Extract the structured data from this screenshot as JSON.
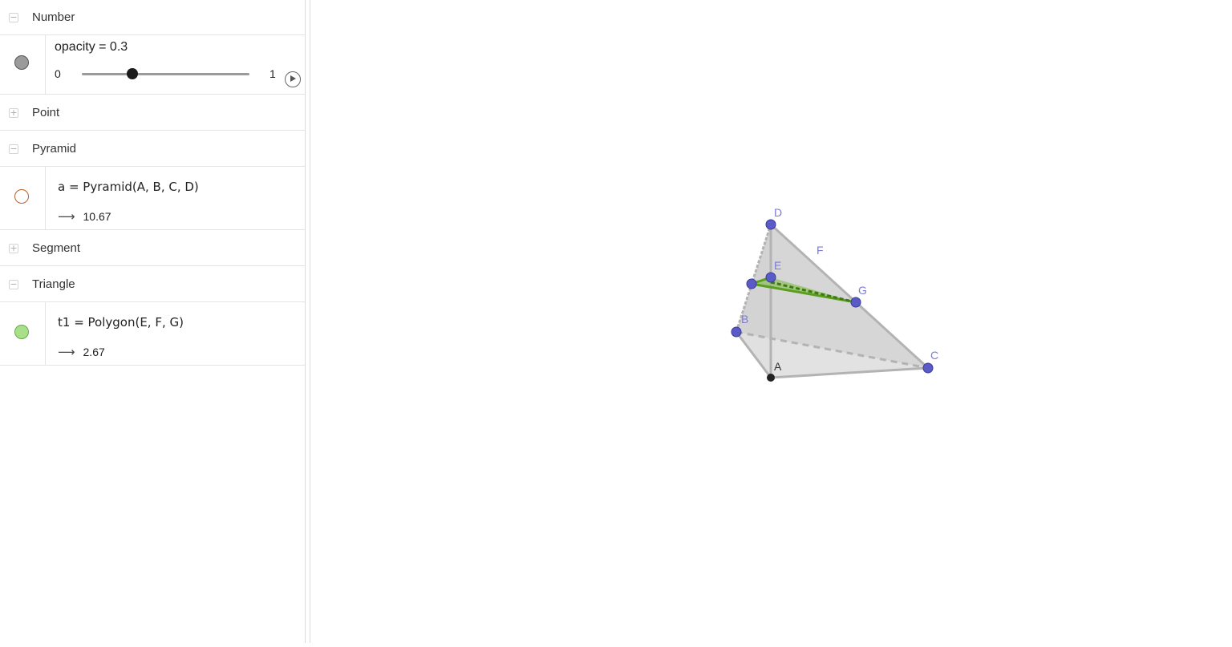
{
  "algebra": {
    "groups": {
      "number": {
        "label": "Number",
        "toggle": "−"
      },
      "point": {
        "label": "Point",
        "toggle": "+"
      },
      "pyramid": {
        "label": "Pyramid",
        "toggle": "−"
      },
      "segment": {
        "label": "Segment",
        "toggle": "+"
      },
      "triangle": {
        "label": "Triangle",
        "toggle": "−"
      }
    },
    "slider": {
      "text": "opacity = 0.3",
      "min": "0",
      "max": "1",
      "value": 0.3,
      "marble_color": "#9b9b9b"
    },
    "pyramid_item": {
      "definition": "a  =  Pyramid(A, B, C, D)",
      "arrow": "⟶",
      "value": "10.67",
      "marble_color": "#b5602a"
    },
    "triangle_item": {
      "definition": "t1  =  Polygon(E, F, G)",
      "arrow": "⟶",
      "value": "2.67",
      "marble_color": "#a8e08a"
    }
  },
  "graphics": {
    "labels": {
      "A": "A",
      "B": "B",
      "C": "C",
      "D": "D",
      "E": "E",
      "F": "F",
      "G": "G"
    },
    "colors": {
      "point": "#5b5bc8",
      "point_A": "#222222",
      "triangle": "#5a9e1f",
      "edge": "#b3b3b3",
      "face": "#c8c8c8"
    }
  }
}
